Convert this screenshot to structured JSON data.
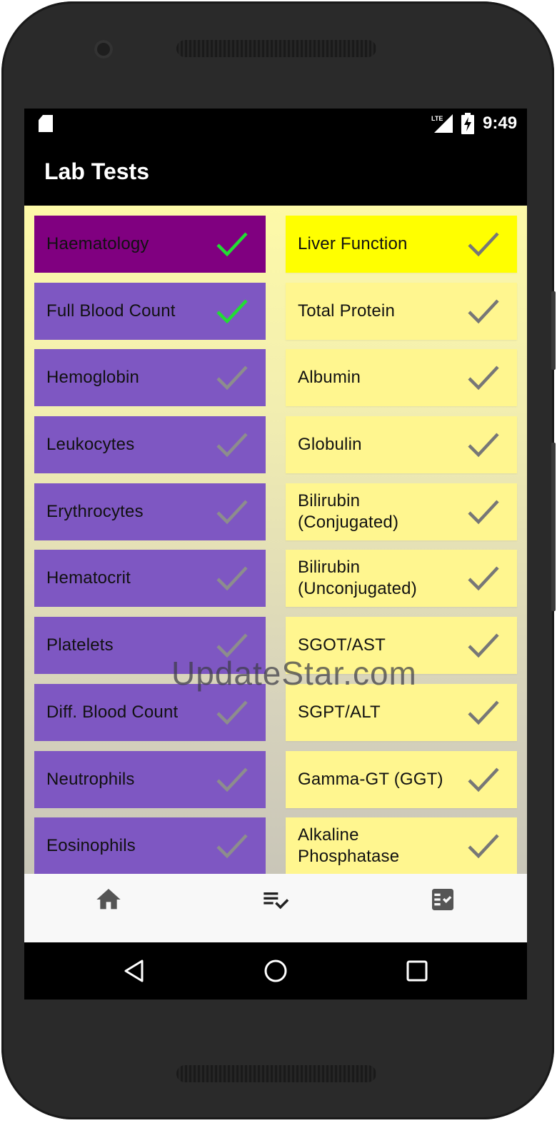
{
  "status_bar": {
    "time": "9:49",
    "network": "LTE",
    "icons": [
      "sd-card-icon",
      "lte-signal-icon",
      "battery-charging-icon"
    ]
  },
  "app_bar": {
    "title": "Lab Tests"
  },
  "watermark": "UpdateStar.com",
  "left_column": {
    "color": "#7e57c2",
    "selected_color": "#800080",
    "items": [
      {
        "label": "Haematology",
        "checked": true,
        "selected": true
      },
      {
        "label": "Full Blood Count",
        "checked": true,
        "selected": false
      },
      {
        "label": "Hemoglobin",
        "checked": false,
        "selected": false
      },
      {
        "label": "Leukocytes",
        "checked": false,
        "selected": false
      },
      {
        "label": "Erythrocytes",
        "checked": false,
        "selected": false
      },
      {
        "label": "Hematocrit",
        "checked": false,
        "selected": false
      },
      {
        "label": "Platelets",
        "checked": false,
        "selected": false
      },
      {
        "label": "Diff. Blood Count",
        "checked": false,
        "selected": false
      },
      {
        "label": "Neutrophils",
        "checked": false,
        "selected": false
      },
      {
        "label": "Eosinophils",
        "checked": false,
        "selected": false
      }
    ]
  },
  "right_column": {
    "color": "#fff68f",
    "selected_color": "#ffff00",
    "items": [
      {
        "label": "Liver Function",
        "checked": false,
        "selected": true
      },
      {
        "label": "Total Protein",
        "checked": false,
        "selected": false
      },
      {
        "label": "Albumin",
        "checked": false,
        "selected": false
      },
      {
        "label": "Globulin",
        "checked": false,
        "selected": false
      },
      {
        "label": "Bilirubin (Conjugated)",
        "checked": false,
        "selected": false
      },
      {
        "label": "Bilirubin (Unconjugated)",
        "checked": false,
        "selected": false
      },
      {
        "label": "SGOT/AST",
        "checked": false,
        "selected": false
      },
      {
        "label": "SGPT/ALT",
        "checked": false,
        "selected": false
      },
      {
        "label": "Gamma-GT (GGT)",
        "checked": false,
        "selected": false
      },
      {
        "label": "Alkaline Phosphatase",
        "checked": false,
        "selected": false
      }
    ]
  },
  "check_colors": {
    "checked": "#22dd33",
    "unchecked_on_purple": "#8d8d8d",
    "unchecked_on_yellow": "#777777"
  },
  "bottom_nav": {
    "items": [
      {
        "icon": "home-icon"
      },
      {
        "icon": "playlist-check-icon"
      },
      {
        "icon": "checkbox-list-icon"
      }
    ],
    "icon_color": "#555555"
  },
  "system_nav": {
    "items": [
      {
        "icon": "back-triangle-icon"
      },
      {
        "icon": "home-circle-icon"
      },
      {
        "icon": "recents-square-icon"
      }
    ]
  }
}
